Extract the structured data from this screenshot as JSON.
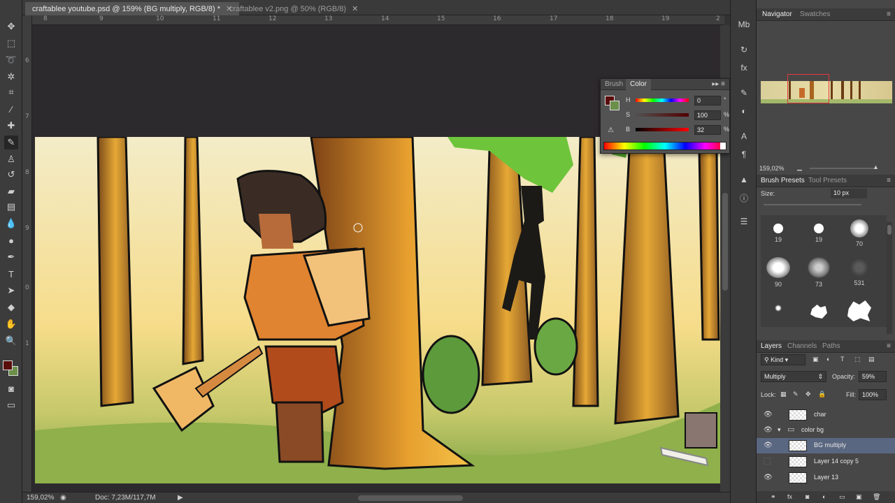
{
  "tabs": [
    {
      "label": "craftablee youtube.psd @ 159% (BG multiply, RGB/8) *",
      "active": true
    },
    {
      "label": "craftablee v2.png @ 50% (RGB/8)",
      "active": false
    }
  ],
  "ruler_h_labels": [
    "8",
    "9",
    "10",
    "11",
    "12",
    "13",
    "14",
    "15",
    "16",
    "17",
    "18",
    "19",
    "2"
  ],
  "ruler_v_labels": [
    "6",
    "7",
    "8",
    "9",
    "0",
    "1"
  ],
  "color_panel": {
    "tabs": [
      "Brush",
      "Color"
    ],
    "h": {
      "label": "H",
      "value": "0",
      "unit": "°"
    },
    "s": {
      "label": "S",
      "value": "100",
      "unit": "%"
    },
    "b": {
      "label": "B",
      "value": "32",
      "unit": "%"
    },
    "foreground": "#5a0e0c",
    "background": "#6c8f4a"
  },
  "navigator": {
    "tabs": [
      "Navigator",
      "Swatches"
    ],
    "zoom": "159,02%"
  },
  "brush_presets": {
    "tabs": [
      "Brush Presets",
      "Tool Presets"
    ],
    "size_label": "Size:",
    "size_value": "10 px",
    "brushes": [
      "19",
      "19",
      "70",
      "90",
      "73",
      "531"
    ]
  },
  "layers": {
    "tabs": [
      "Layers",
      "Channels",
      "Paths"
    ],
    "kind": "Kind",
    "blend_mode": "Multiply",
    "opacity_label": "Opacity:",
    "opacity_value": "59%",
    "lock_label": "Lock:",
    "fill_label": "Fill:",
    "fill_value": "100%",
    "items": [
      {
        "name": "char",
        "visible": true,
        "selected": false
      },
      {
        "name": "color bg",
        "visible": true,
        "selected": false,
        "group": true
      },
      {
        "name": "BG multiply",
        "visible": true,
        "selected": true
      },
      {
        "name": "Layer 14 copy 5",
        "visible": false,
        "selected": false
      },
      {
        "name": "Layer 13",
        "visible": true,
        "selected": false
      }
    ]
  },
  "status": {
    "zoom": "159,02%",
    "doc": "Doc: 7,23M/117,7M"
  },
  "colors": {
    "foreground": "#5a0e0c",
    "background": "#6c8f4a",
    "selected_layer": "#5a6781"
  }
}
